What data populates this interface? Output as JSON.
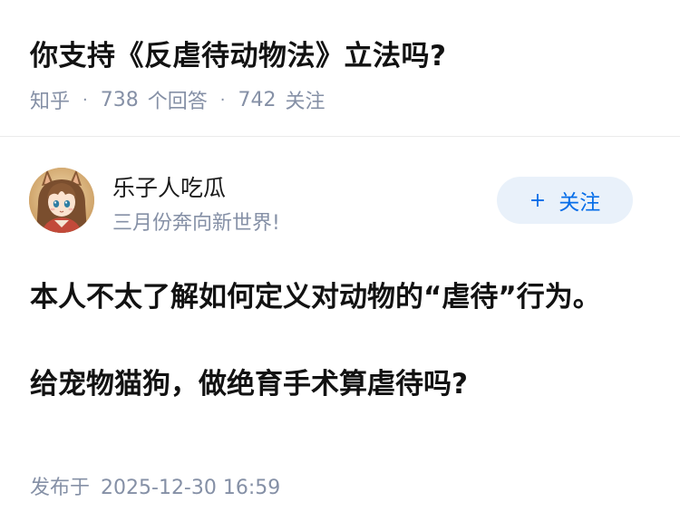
{
  "question": {
    "title": "你支持《反虐待动物法》立法吗?",
    "source": "知乎",
    "answer_count": "738",
    "answer_label": "个回答",
    "follower_count": "742",
    "follower_label": "关注"
  },
  "author": {
    "avatar_icon": "anime-girl-avatar-icon",
    "name": "乐子人吃瓜",
    "bio": "三月份奔向新世界!",
    "follow_button": {
      "icon": "plus-icon",
      "plus": "+",
      "label": "关注"
    }
  },
  "answer": {
    "paragraphs": [
      "本人不太了解如何定义对动物的“虐待”行为。",
      "给宠物猫狗，做绝育手术算虐待吗?"
    ]
  },
  "publish": {
    "label": "发布于",
    "time": "2025-12-30 16:59"
  },
  "colors": {
    "meta_gray": "#8590a6",
    "follow_bg": "#e9f1fa",
    "follow_text": "#056de8"
  }
}
